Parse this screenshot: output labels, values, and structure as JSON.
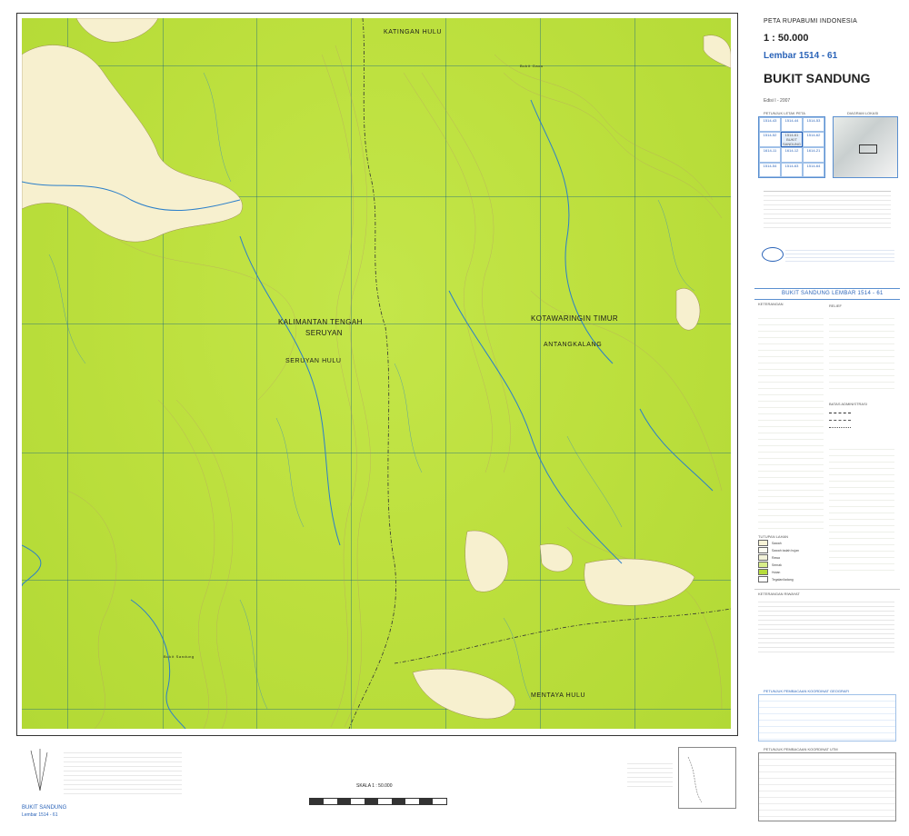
{
  "sheet": {
    "series_title": "PETA RUPABUMI INDONESIA",
    "scale": "1 : 50.000",
    "sheet_number": "Lembar 1514 - 61",
    "sheet_name": "BUKIT SANDUNG",
    "edition": "Edisi I - 2007",
    "banner": "BUKIT SANDUNG   LEMBAR  1514 - 61",
    "bottom_name": "BUKIT SANDUNG",
    "bottom_sheet": "Lembar 1514 - 61",
    "scale_text": "SKALA 1 : 50.000"
  },
  "map": {
    "labels": {
      "katingan_hulu": "KATINGAN HULU",
      "bukit_gaou": "Bukit Gaou",
      "kalimantan_tengah": "KALIMANTAN TENGAH",
      "seruyan": "SERUYAN",
      "seruyan_hulu": "SERUYAN HULU",
      "kotawaringin_timur": "KOTAWARINGIN TIMUR",
      "antangkalang": "ANTANGKALANG",
      "mentaya_hulu": "MENTAYA HULU",
      "bukit_sandung": "Bukit Sandung"
    },
    "colors": {
      "vegetation": "#bde03e",
      "open_area": "#f7f0cf",
      "river": "#2b7fc9",
      "grid": "#1f6aa5",
      "contour": "#b8956a"
    }
  },
  "panel": {
    "index_title": "PETUNJUK LETAK PETA",
    "diagram_title": "DIAGRAM LOKASI",
    "index_cells": [
      "1514-43",
      "1514-44",
      "1514-53",
      "1514-52",
      "1514-61 BUKIT SANDUNG",
      "1514-62",
      "1614-11",
      "1614-12",
      "1614-21",
      "1514-54",
      "1514-63",
      "1514-64"
    ],
    "legend_title": "KETERANGAN",
    "coverage_title": "TUTUPAN LAHAN",
    "coverage_items": [
      "Sawah",
      "Sawah tadah hujan",
      "Rawa",
      "Semak",
      "Hutan",
      "Tegalan/ladang"
    ],
    "relief_title": "RELIEF",
    "bounds_title": "BATAS ADMINISTRASI",
    "notes_title": "KETERANGAN RIWAYAT",
    "grid_title": "PETUNJUK PEMBACAAN KOORDINAT GEOGRAFI",
    "utm_title": "PETUNJUK PEMBACAAN KOORDINAT UTM"
  }
}
